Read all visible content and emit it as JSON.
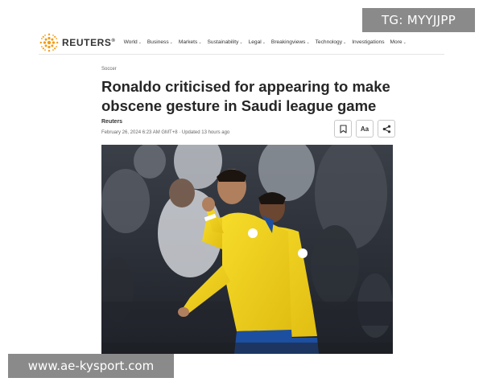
{
  "watermarks": {
    "top": "TG: MYYJJPP",
    "bottom": "www.ae-kysport.com"
  },
  "nav": {
    "logo_text": "REUTERS",
    "logo_mark": "®",
    "items": [
      {
        "label": "World"
      },
      {
        "label": "Business"
      },
      {
        "label": "Markets"
      },
      {
        "label": "Sustainability"
      },
      {
        "label": "Legal"
      },
      {
        "label": "Breakingviews"
      },
      {
        "label": "Technology"
      },
      {
        "label": "Investigations"
      },
      {
        "label": "More"
      }
    ]
  },
  "article": {
    "category": "Soccer",
    "headline_line1": "Ronaldo criticised for appearing to make",
    "headline_line2": "obscene gesture in Saudi league game",
    "author": "Reuters",
    "dateline": "February 26, 2024 6:23 AM GMT+8 · Updated 13 hours ago"
  },
  "tools": {
    "font_size_label": "Aa"
  },
  "icons": {
    "logo": "reuters-dot-logo-icon",
    "bookmark": "bookmark-icon",
    "share": "share-icon",
    "chevron": "chevron-down-icon"
  },
  "colors": {
    "brand_orange": "#f5a623",
    "jersey_yellow": "#f2d21b",
    "shorts_blue": "#1d4fa0"
  }
}
